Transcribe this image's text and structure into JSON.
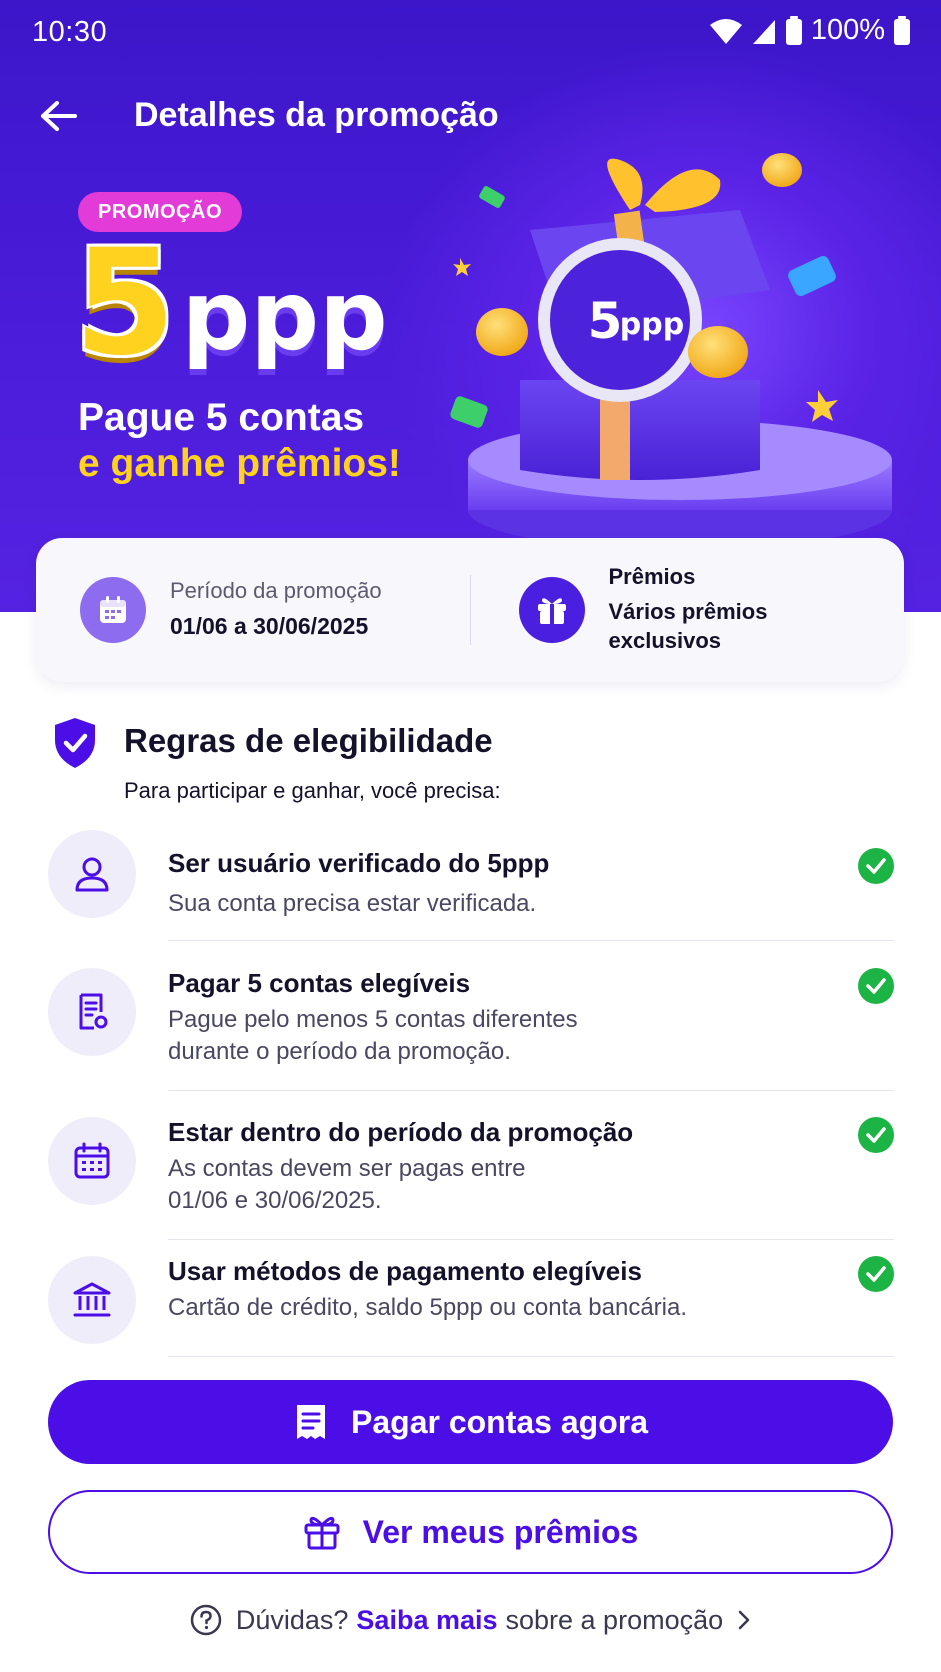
{
  "status_bar": {
    "time": "10:30",
    "battery": "100%"
  },
  "app_bar": {
    "title": "Detalhes da promoção"
  },
  "hero": {
    "badge": "PROMOÇÃO",
    "brand_number": "5",
    "brand_text": "ppp",
    "headline_line1": "Pague 5 contas",
    "headline_line2": "e ganhe prêmios!",
    "coin_label_number": "5",
    "coin_label_text": "ppp"
  },
  "info_card": {
    "period_label": "Período da promoção",
    "period_value": "01/06 a 30/06/2025",
    "prizes_label": "Prêmios",
    "prizes_value_line1": "Vários prêmios",
    "prizes_value_line2": "exclusivos"
  },
  "rules": {
    "title": "Regras de elegibilidade",
    "subtitle": "Para participar e ganhar, você precisa:",
    "items": [
      {
        "title": "Ser usuário verificado do 5ppp",
        "desc_line1": "Sua conta precisa estar verificada.",
        "desc_line2": "",
        "icon": "user-icon"
      },
      {
        "title": "Pagar 5 contas elegíveis",
        "desc_line1": "Pague pelo menos 5 contas diferentes",
        "desc_line2": "durante o período da promoção.",
        "icon": "bill-icon"
      },
      {
        "title": "Estar dentro do período da promoção",
        "desc_line1": "As contas devem ser pagas entre",
        "desc_line2": "01/06 e 30/06/2025.",
        "icon": "calendar-icon"
      },
      {
        "title": "Usar métodos de pagamento elegíveis",
        "desc_line1": "Cartão de crédito, saldo 5ppp ou conta bancária.",
        "desc_line2": "",
        "icon": "bank-icon"
      }
    ]
  },
  "buttons": {
    "primary": "Pagar contas agora",
    "secondary": "Ver meus prêmios"
  },
  "faq": {
    "prefix": "Dúvidas?",
    "link": "Saiba mais",
    "suffix": "sobre a promoção"
  },
  "colors": {
    "brand_purple": "#4b0ee6",
    "accent_yellow": "#ffd21f",
    "badge_pink": "#e23bd8",
    "check_green": "#1db446"
  }
}
